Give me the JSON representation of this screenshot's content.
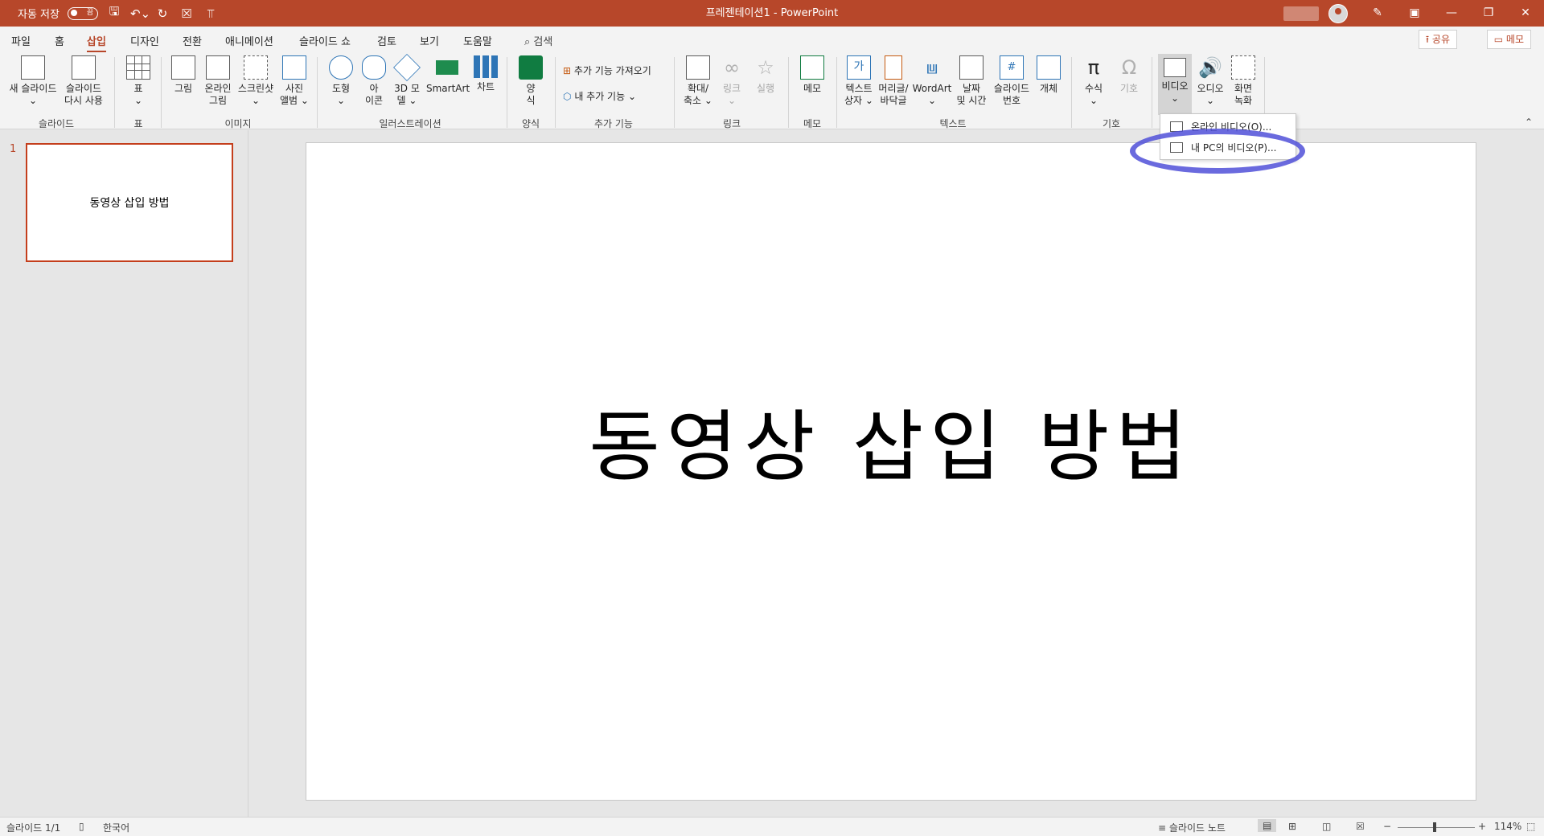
{
  "titlebar": {
    "autosave_label": "자동 저장",
    "autosave_state": "끔",
    "document_title": "프레젠테이션1  -  PowerPoint",
    "accent": "#b7472a"
  },
  "tabs": [
    "파일",
    "홈",
    "삽입",
    "디자인",
    "전환",
    "애니메이션",
    "슬라이드 쇼",
    "검토",
    "보기",
    "도움말"
  ],
  "search_label": "검색",
  "share_label": "공유",
  "memo_label": "메모",
  "ribbon": {
    "new_slide": "새 슬라이드",
    "reuse_slide_1": "슬라이드",
    "reuse_slide_2": "다시 사용",
    "group_slides": "슬라이드",
    "table": "표",
    "group_table": "표",
    "picture": "그림",
    "online_picture_1": "온라인",
    "online_picture_2": "그림",
    "screenshot": "스크린샷",
    "photo_album_1": "사진",
    "photo_album_2": "앨범",
    "group_images": "이미지",
    "shapes": "도형",
    "icons_1": "아",
    "icons_2": "이콘",
    "model3d_1": "3D 모",
    "model3d_2": "델",
    "smartart": "SmartArt",
    "chart": "차트",
    "group_illustrations": "일러스트레이션",
    "forms_1": "양",
    "forms_2": "식",
    "group_forms": "양식",
    "get_addins": "추가 기능 가져오기",
    "my_addins": "내 추가 기능",
    "group_addins": "추가 기능",
    "zoom_1": "확대/",
    "zoom_2": "축소",
    "link": "링크",
    "action": "실행",
    "group_links": "링크",
    "comment": "메모",
    "group_comments": "메모",
    "textbox_1": "텍스트",
    "textbox_2": "상자",
    "header_1": "머리글/",
    "header_2": "바닥글",
    "wordart": "WordArt",
    "datetime_1": "날짜",
    "datetime_2": "및 시간",
    "slidenum_1": "슬라이드",
    "slidenum_2": "번호",
    "object": "개체",
    "group_text": "텍스트",
    "equation": "수식",
    "symbol": "기호",
    "group_symbols": "기호",
    "video": "비디오",
    "audio": "오디오",
    "screen_rec_1": "화면",
    "screen_rec_2": "녹화"
  },
  "video_menu": {
    "online": "온라인 비디오(O)...",
    "this_pc": "내 PC의 비디오(P)..."
  },
  "slides_panel": {
    "number": "1",
    "thumb_title": "동영상 삽입 방법"
  },
  "slide": {
    "title": "동영상 삽입 방법"
  },
  "statusbar": {
    "slide_count": "슬라이드 1/1",
    "language": "한국어",
    "notes": "슬라이드 노트",
    "zoom": "114%"
  }
}
